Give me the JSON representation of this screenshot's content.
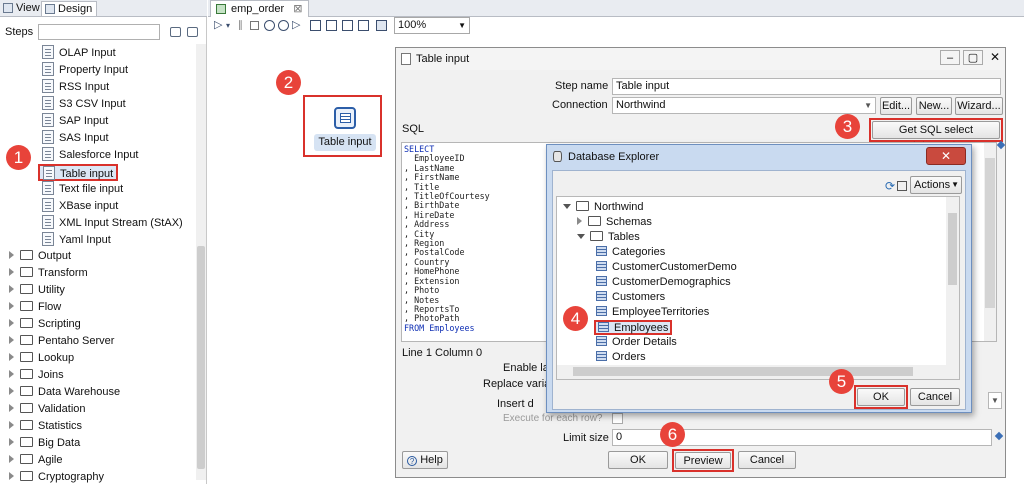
{
  "left_panel": {
    "tabs": [
      {
        "label": "View"
      },
      {
        "label": "Design"
      }
    ],
    "steps_label": "Steps",
    "search_value": "",
    "input_steps": [
      {
        "label": "OLAP Input"
      },
      {
        "label": "Property Input"
      },
      {
        "label": "RSS Input"
      },
      {
        "label": "S3 CSV Input"
      },
      {
        "label": "SAP Input"
      },
      {
        "label": "SAS Input"
      },
      {
        "label": "Salesforce Input"
      },
      {
        "label": "Table input"
      },
      {
        "label": "Text file input"
      },
      {
        "label": "XBase input"
      },
      {
        "label": "XML Input Stream (StAX)"
      },
      {
        "label": "Yaml Input"
      }
    ],
    "categories": [
      {
        "label": "Output"
      },
      {
        "label": "Transform"
      },
      {
        "label": "Utility"
      },
      {
        "label": "Flow"
      },
      {
        "label": "Scripting"
      },
      {
        "label": "Pentaho Server"
      },
      {
        "label": "Lookup"
      },
      {
        "label": "Joins"
      },
      {
        "label": "Data Warehouse"
      },
      {
        "label": "Validation"
      },
      {
        "label": "Statistics"
      },
      {
        "label": "Big Data"
      },
      {
        "label": "Agile"
      },
      {
        "label": "Cryptography"
      }
    ]
  },
  "canvas": {
    "tab_title": "emp_order",
    "zoom": "100%",
    "step_node_label": "Table input"
  },
  "badges": [
    "1",
    "2",
    "3",
    "4",
    "5",
    "6"
  ],
  "table_input_dialog": {
    "title": "Table input",
    "step_name_label": "Step name",
    "step_name_value": "Table input",
    "connection_label": "Connection",
    "connection_value": "Northwind",
    "edit_button": "Edit...",
    "new_button": "New...",
    "wizard_button": "Wizard...",
    "sql_label": "SQL",
    "get_sql_button": "Get SQL select statement...",
    "sql_lines": [
      {
        "text": "SELECT",
        "kw": true
      },
      {
        "text": "  EmployeeID",
        "kw": false
      },
      {
        "text": ", LastName",
        "kw": false
      },
      {
        "text": ", FirstName",
        "kw": false
      },
      {
        "text": ", Title",
        "kw": false
      },
      {
        "text": ", TitleOfCourtesy",
        "kw": false
      },
      {
        "text": ", BirthDate",
        "kw": false
      },
      {
        "text": ", HireDate",
        "kw": false
      },
      {
        "text": ", Address",
        "kw": false
      },
      {
        "text": ", City",
        "kw": false
      },
      {
        "text": ", Region",
        "kw": false
      },
      {
        "text": ", PostalCode",
        "kw": false
      },
      {
        "text": ", Country",
        "kw": false
      },
      {
        "text": ", HomePhone",
        "kw": false
      },
      {
        "text": ", Extension",
        "kw": false
      },
      {
        "text": ", Photo",
        "kw": false
      },
      {
        "text": ", Notes",
        "kw": false
      },
      {
        "text": ", ReportsTo",
        "kw": false
      },
      {
        "text": ", PhotoPath",
        "kw": false
      },
      {
        "text": "FROM Employees",
        "kw": true
      }
    ],
    "position_text": "Line 1 Column 0",
    "enable_lazy_label": "Enable la",
    "replace_vars_label": "Replace varia",
    "insert_data_label": "Insert d",
    "execute_each_row_label": "Execute for each row?",
    "limit_size_label": "Limit size",
    "limit_size_value": "0",
    "help_button": "Help",
    "ok_button": "OK",
    "preview_button": "Preview",
    "cancel_button": "Cancel"
  },
  "database_explorer": {
    "title": "Database Explorer",
    "actions_button": "Actions",
    "tree": {
      "root": "Northwind",
      "schemas": "Schemas",
      "tables_label": "Tables",
      "tables": [
        {
          "label": "Categories"
        },
        {
          "label": "CustomerCustomerDemo"
        },
        {
          "label": "CustomerDemographics"
        },
        {
          "label": "Customers"
        },
        {
          "label": "EmployeeTerritories"
        },
        {
          "label": "Employees"
        },
        {
          "label": "Order Details"
        },
        {
          "label": "Orders"
        }
      ]
    },
    "ok_button": "OK",
    "cancel_button": "Cancel"
  },
  "colors": {
    "highlight": "#d9312b",
    "badge": "#e8433a",
    "title_active": "#c9daf0"
  }
}
